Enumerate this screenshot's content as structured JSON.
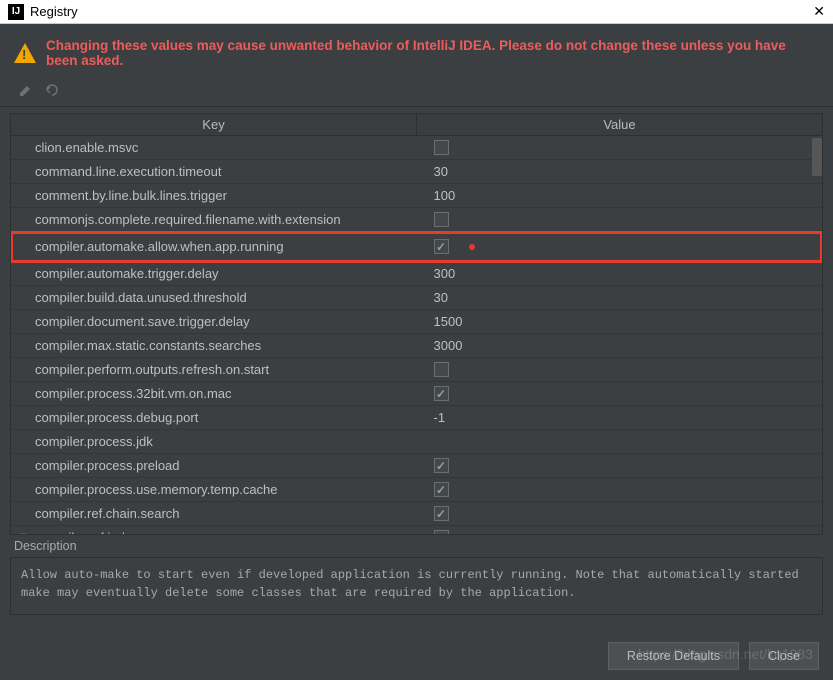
{
  "titlebar": {
    "title": "Registry"
  },
  "warning": "Changing these values may cause unwanted behavior of IntelliJ IDEA. Please do not change these unless you have been asked.",
  "table": {
    "headers": {
      "key": "Key",
      "value": "Value"
    },
    "rows": [
      {
        "key": "clion.enable.msvc",
        "type": "check",
        "checked": false
      },
      {
        "key": "command.line.execution.timeout",
        "type": "text",
        "value": "30"
      },
      {
        "key": "comment.by.line.bulk.lines.trigger",
        "type": "text",
        "value": "100"
      },
      {
        "key": "commonjs.complete.required.filename.with.extension",
        "type": "check",
        "checked": false
      },
      {
        "key": "compiler.automake.allow.when.app.running",
        "type": "check",
        "checked": true,
        "highlight": true,
        "dot": true
      },
      {
        "key": "compiler.automake.trigger.delay",
        "type": "text",
        "value": "300"
      },
      {
        "key": "compiler.build.data.unused.threshold",
        "type": "text",
        "value": "30"
      },
      {
        "key": "compiler.document.save.trigger.delay",
        "type": "text",
        "value": "1500"
      },
      {
        "key": "compiler.max.static.constants.searches",
        "type": "text",
        "value": "3000"
      },
      {
        "key": "compiler.perform.outputs.refresh.on.start",
        "type": "check",
        "checked": false
      },
      {
        "key": "compiler.process.32bit.vm.on.mac",
        "type": "check",
        "checked": true
      },
      {
        "key": "compiler.process.debug.port",
        "type": "text",
        "value": "-1"
      },
      {
        "key": "compiler.process.jdk",
        "type": "text",
        "value": ""
      },
      {
        "key": "compiler.process.preload",
        "type": "check",
        "checked": true
      },
      {
        "key": "compiler.process.use.memory.temp.cache",
        "type": "check",
        "checked": true
      },
      {
        "key": "compiler.ref.chain.search",
        "type": "check",
        "checked": true
      },
      {
        "key": "compiler.ref.index",
        "type": "check",
        "checked": true,
        "caret": true
      }
    ]
  },
  "description": {
    "label": "Description",
    "text": "Allow auto-make to start even if developed application is currently running. Note that automatically started make may eventually delete some classes that are required by the application."
  },
  "footer": {
    "restore": "Restore Defaults",
    "close": "Close"
  },
  "watermark": "https://blog.csdn.net/kq1983"
}
